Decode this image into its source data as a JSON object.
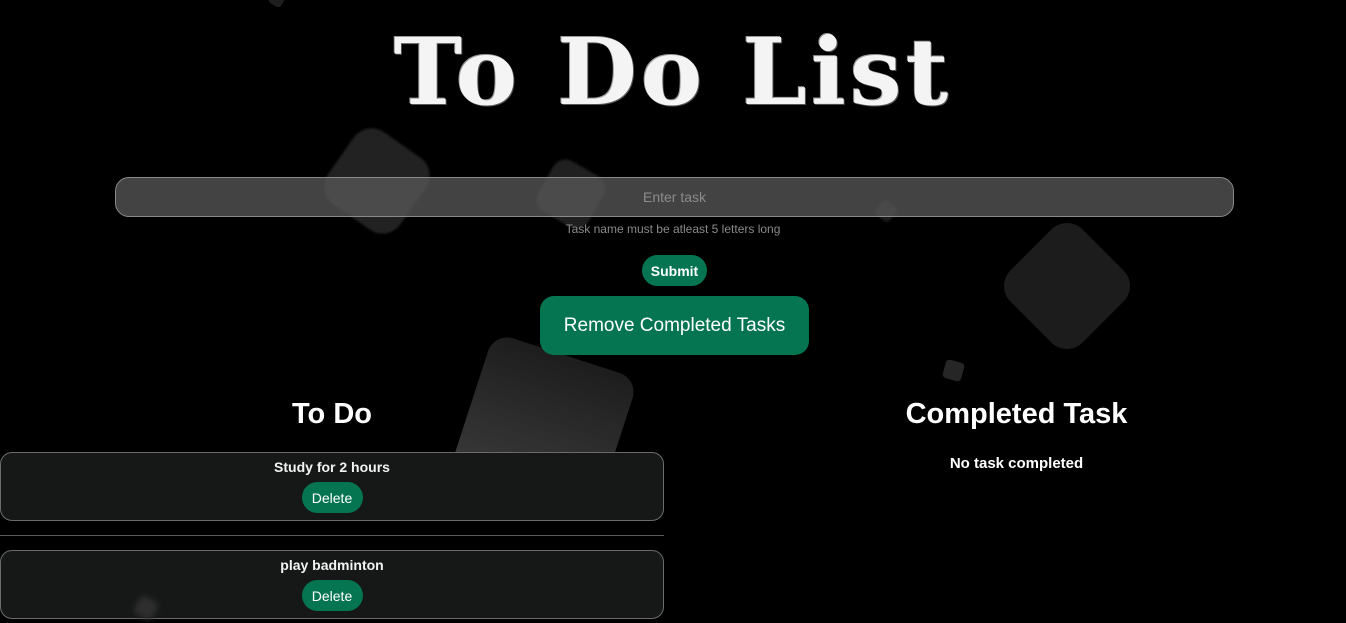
{
  "header": {
    "title": "To Do List"
  },
  "form": {
    "input_placeholder": "Enter task",
    "input_value": "",
    "hint": "Task name must be atleast 5 letters long",
    "submit_label": "Submit",
    "remove_completed_label": "Remove Completed Tasks"
  },
  "todo": {
    "heading": "To Do",
    "tasks": [
      {
        "name": "Study for 2 hours",
        "delete_label": "Delete"
      },
      {
        "name": "play badminton",
        "delete_label": "Delete"
      }
    ]
  },
  "completed": {
    "heading": "Completed Task",
    "empty_message": "No task completed"
  },
  "colors": {
    "background": "#000000",
    "accent": "#057551",
    "card": "#161818"
  }
}
